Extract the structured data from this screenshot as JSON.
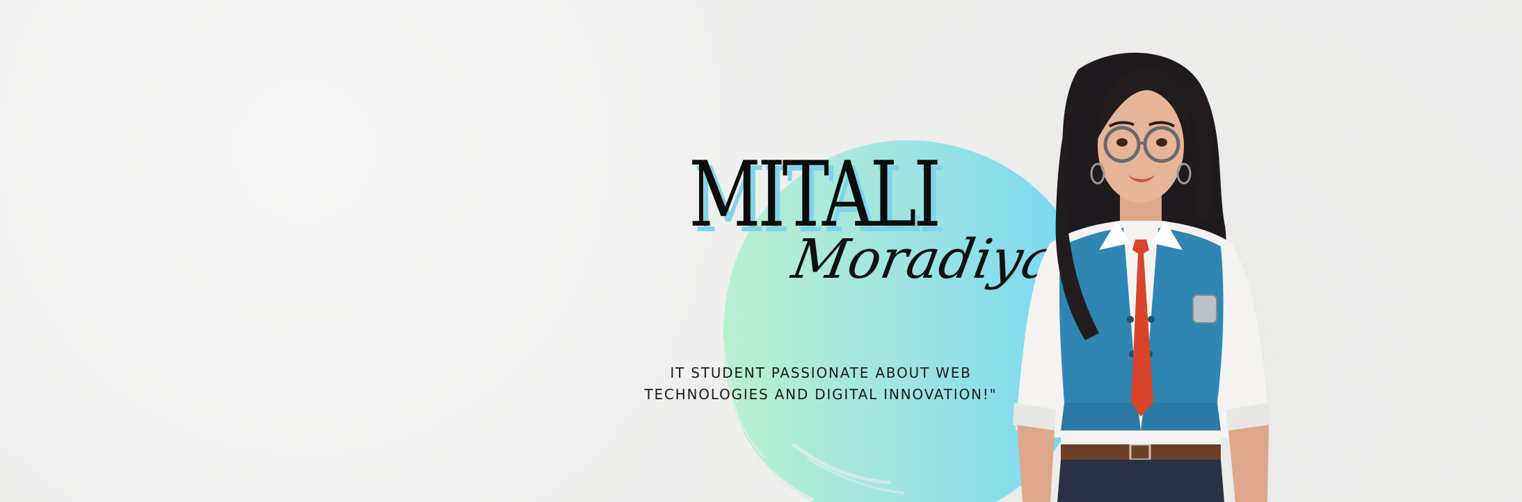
{
  "banner": {
    "first_name": "MITALI",
    "last_name": "Moradiya",
    "tagline_line1": "IT STUDENT PASSIONATE ABOUT WEB",
    "tagline_line2": "TECHNOLOGIES AND DIGITAL INNOVATION!\""
  },
  "colors": {
    "background": "#efefee",
    "circle_start": "#b6efcf",
    "circle_end": "#74d7f3",
    "name_shadow": "#7fd4ea",
    "text": "#111111",
    "vest": "#2f86b3",
    "tie": "#d9452b"
  },
  "illustration": {
    "subject": "avatar-illustration",
    "icon": "student-avatar-icon"
  }
}
